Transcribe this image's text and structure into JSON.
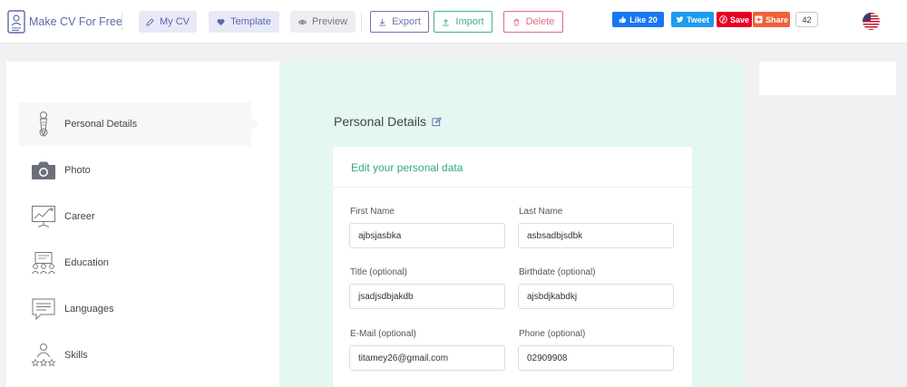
{
  "app": {
    "name": "Make CV For Free"
  },
  "nav": {
    "mycv": "My CV",
    "template": "Template",
    "preview": "Preview",
    "export": "Export",
    "import": "Import",
    "delete": "Delete"
  },
  "social": {
    "like": "Like 20",
    "tweet": "Tweet",
    "save": "Save",
    "share": "Share",
    "count": "42"
  },
  "sidebar": {
    "items": [
      {
        "label": "Personal Details",
        "icon": "person-tie-icon",
        "active": true
      },
      {
        "label": "Photo",
        "icon": "camera-icon",
        "active": false
      },
      {
        "label": "Career",
        "icon": "career-chart-icon",
        "active": false
      },
      {
        "label": "Education",
        "icon": "education-icon",
        "active": false
      },
      {
        "label": "Languages",
        "icon": "speech-bubble-icon",
        "active": false
      },
      {
        "label": "Skills",
        "icon": "person-stars-icon",
        "active": false
      }
    ]
  },
  "section": {
    "title": "Personal Details",
    "card_title": "Edit your personal data"
  },
  "form": {
    "first_name": {
      "label": "First Name",
      "value": "ajbsjasbka"
    },
    "last_name": {
      "label": "Last Name",
      "value": "asbsadbjsdbk"
    },
    "title": {
      "label": "Title (optional)",
      "value": "jsadjsdbjakdb"
    },
    "birthdate": {
      "label": "Birthdate (optional)",
      "value": "ajsbdjkabdkj"
    },
    "email": {
      "label": "E-Mail (optional)",
      "value": "titamey26@gmail.com"
    },
    "phone": {
      "label": "Phone (optional)",
      "value": "02909908"
    }
  },
  "colors": {
    "accent": "#5b6aa8",
    "green": "#30a884",
    "mint_bg": "#e4f7f1",
    "delete": "#e06b83"
  }
}
